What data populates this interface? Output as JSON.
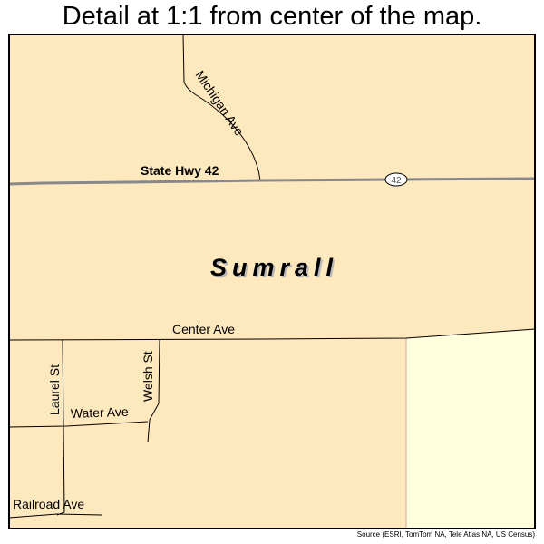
{
  "title": "Detail at 1:1 from center of the map.",
  "town_name": "Sumrall",
  "roads": {
    "highway": "State Hwy 42",
    "highway_shield": "42",
    "michigan": "Michigan Ave",
    "center": "Center Ave",
    "laurel": "Laurel St",
    "welsh": "Welsh St",
    "water": "Water Ave",
    "railroad": "Railroad Ave"
  },
  "source": "Source (ESRI, TomTom NA, Tele Atlas NA, US Census)",
  "colors": {
    "land": "#FEE8BE",
    "adjacent_area": "#FFFFDD",
    "highway": "#888888",
    "boundary": "#D8A0A0"
  }
}
